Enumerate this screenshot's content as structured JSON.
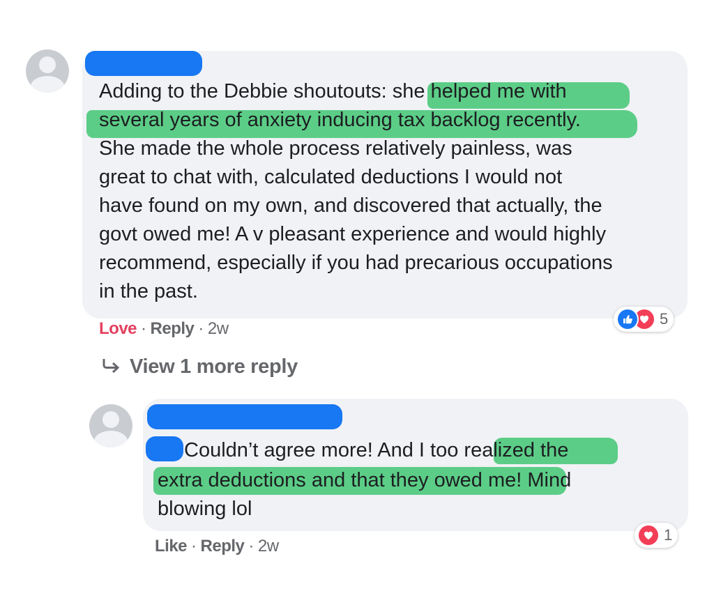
{
  "comments": [
    {
      "lines": [
        "Adding to the Debbie shoutouts: she helped me with",
        "several years of anxiety inducing tax backlog recently.",
        "She made the whole process relatively painless, was",
        "great to chat with, calculated deductions I would not",
        "have found on my own, and discovered that actually, the",
        "govt owed me! A v pleasant experience and would highly",
        "recommend, especially if you had precarious occupations",
        "in the past."
      ],
      "action_primary": "Love",
      "reply_label": "Reply",
      "time": "2w",
      "reaction_count": "5",
      "reaction_icons": [
        "like-icon",
        "love-icon"
      ]
    },
    {
      "lines": [
        "Couldn’t agree more! And I too realized the",
        "extra deductions and that they owed me! Mind",
        "blowing lol"
      ],
      "action_primary": "Like",
      "reply_label": "Reply",
      "time": "2w",
      "reaction_count": "1",
      "reaction_icons": [
        "love-icon"
      ]
    }
  ],
  "view_more_replies": "View 1 more reply",
  "colors": {
    "highlight": "#5ccd87",
    "redaction": "#1877f2",
    "bubble": "#f0f2f5",
    "love": "#e4405f"
  }
}
